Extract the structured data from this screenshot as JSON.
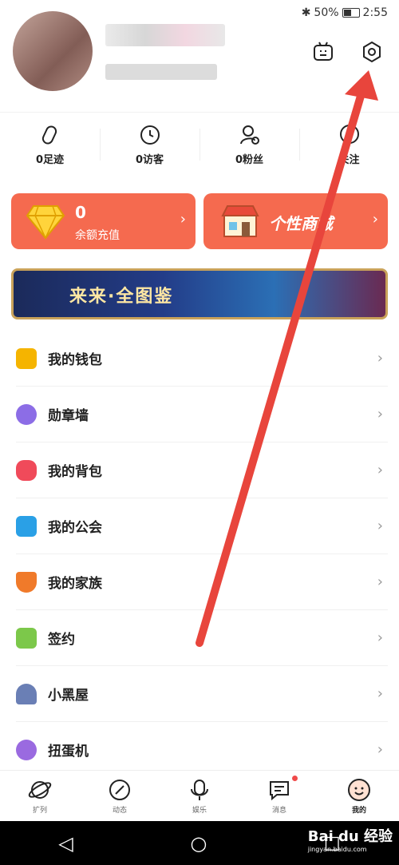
{
  "status_bar": {
    "battery": "50%",
    "time": "2:55"
  },
  "stats": [
    {
      "icon": "footprint-icon",
      "label": "0足迹"
    },
    {
      "icon": "clock-icon",
      "label": "0访客"
    },
    {
      "icon": "user-icon",
      "label": "0粉丝"
    },
    {
      "icon": "heart-icon",
      "label": "关注"
    }
  ],
  "cards": {
    "balance": {
      "value": "0",
      "label": "余额充值"
    },
    "shop": {
      "label": "个性商城"
    }
  },
  "banner": {
    "title": "来来·全图鉴"
  },
  "menu": [
    {
      "label": "我的钱包",
      "icon": "wallet-icon",
      "color": "#f5b400"
    },
    {
      "label": "勋章墙",
      "icon": "medal-icon",
      "color": "#8c6de6"
    },
    {
      "label": "我的背包",
      "icon": "backpack-icon",
      "color": "#f04a5a"
    },
    {
      "label": "我的公会",
      "icon": "guild-icon",
      "color": "#2aa0e6"
    },
    {
      "label": "我的家族",
      "icon": "family-shield-icon",
      "color": "#f07a2a"
    },
    {
      "label": "签约",
      "icon": "contract-icon",
      "color": "#7cc84a"
    },
    {
      "label": "小黑屋",
      "icon": "dark-room-icon",
      "color": "#6a7fb5"
    },
    {
      "label": "扭蛋机",
      "icon": "gacha-icon",
      "color": "#9a6ae0"
    }
  ],
  "tabs": [
    {
      "label": "扩列",
      "icon": "planet-icon"
    },
    {
      "label": "动态",
      "icon": "compass-icon"
    },
    {
      "label": "娱乐",
      "icon": "microphone-icon"
    },
    {
      "label": "消息",
      "icon": "message-icon"
    },
    {
      "label": "我的",
      "icon": "smile-icon"
    }
  ],
  "watermark": {
    "brand": "Bai du 经验",
    "url": "jingyan.baidu.com"
  },
  "colors": {
    "accent": "#f56a4f",
    "arrow": "#e8453c"
  }
}
